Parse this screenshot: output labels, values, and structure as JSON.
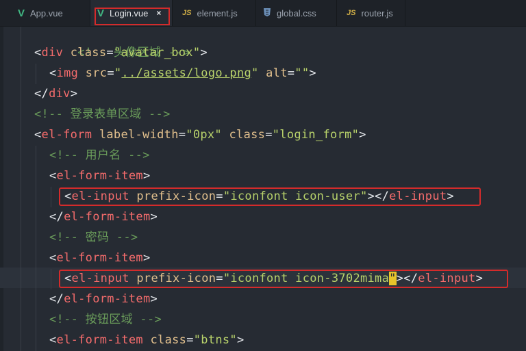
{
  "tabs": [
    {
      "label": "App.vue",
      "icon": "vue-icon",
      "active": false
    },
    {
      "label": "Login.vue",
      "icon": "vue-icon",
      "active": true,
      "close": "×"
    },
    {
      "label": "element.js",
      "icon": "js-icon",
      "active": false
    },
    {
      "label": "global.css",
      "icon": "css-icon",
      "active": false
    },
    {
      "label": "router.js",
      "icon": "js-icon",
      "active": false
    }
  ],
  "icons": {
    "vue": "V",
    "js": "JS",
    "css": "CSS"
  },
  "colors": {
    "highlight_box": "#d42b2b",
    "cursor": "#e8c32a",
    "tag": "#f56c6c",
    "string": "#b9d36b",
    "comment": "#6a9c5a"
  },
  "code": {
    "l0": "<!-- 头像区域 -->",
    "l1_tag": "div",
    "l1_attr": "class",
    "l1_val": "\"avatar_box\"",
    "l2_tag": "img",
    "l2_attr1": "src",
    "l2_val1_q1": "\"",
    "l2_val1_path": "../assets/logo.png",
    "l2_val1_q2": "\"",
    "l2_attr2": "alt",
    "l2_val2": "\"\"",
    "l3_tag": "div",
    "l4_comment": "<!-- 登录表单区域 -->",
    "l5_tag": "el-form",
    "l5_attr1": "label-width",
    "l5_val1": "\"0px\"",
    "l5_attr2": "class",
    "l5_val2": "\"login_form\"",
    "l6_comment": "<!-- 用户名 -->",
    "l7_tag": "el-form-item",
    "l8_tag": "el-input",
    "l8_attr": "prefix-icon",
    "l8_val": "\"iconfont icon-user\"",
    "l8_close": "el-input",
    "l9_tag": "el-form-item",
    "l10_comment": "<!-- 密码 -->",
    "l11_tag": "el-form-item",
    "l12_tag": "el-input",
    "l12_attr": "prefix-icon",
    "l12_val_pre": "\"iconfont icon-3702mima",
    "l12_val_cursor": "\"",
    "l12_close": "el-input",
    "l13_tag": "el-form-item",
    "l14_comment": "<!-- 按钮区域 -->",
    "l15_tag": "el-form-item",
    "l15_attr": "class",
    "l15_val": "\"btns\""
  }
}
